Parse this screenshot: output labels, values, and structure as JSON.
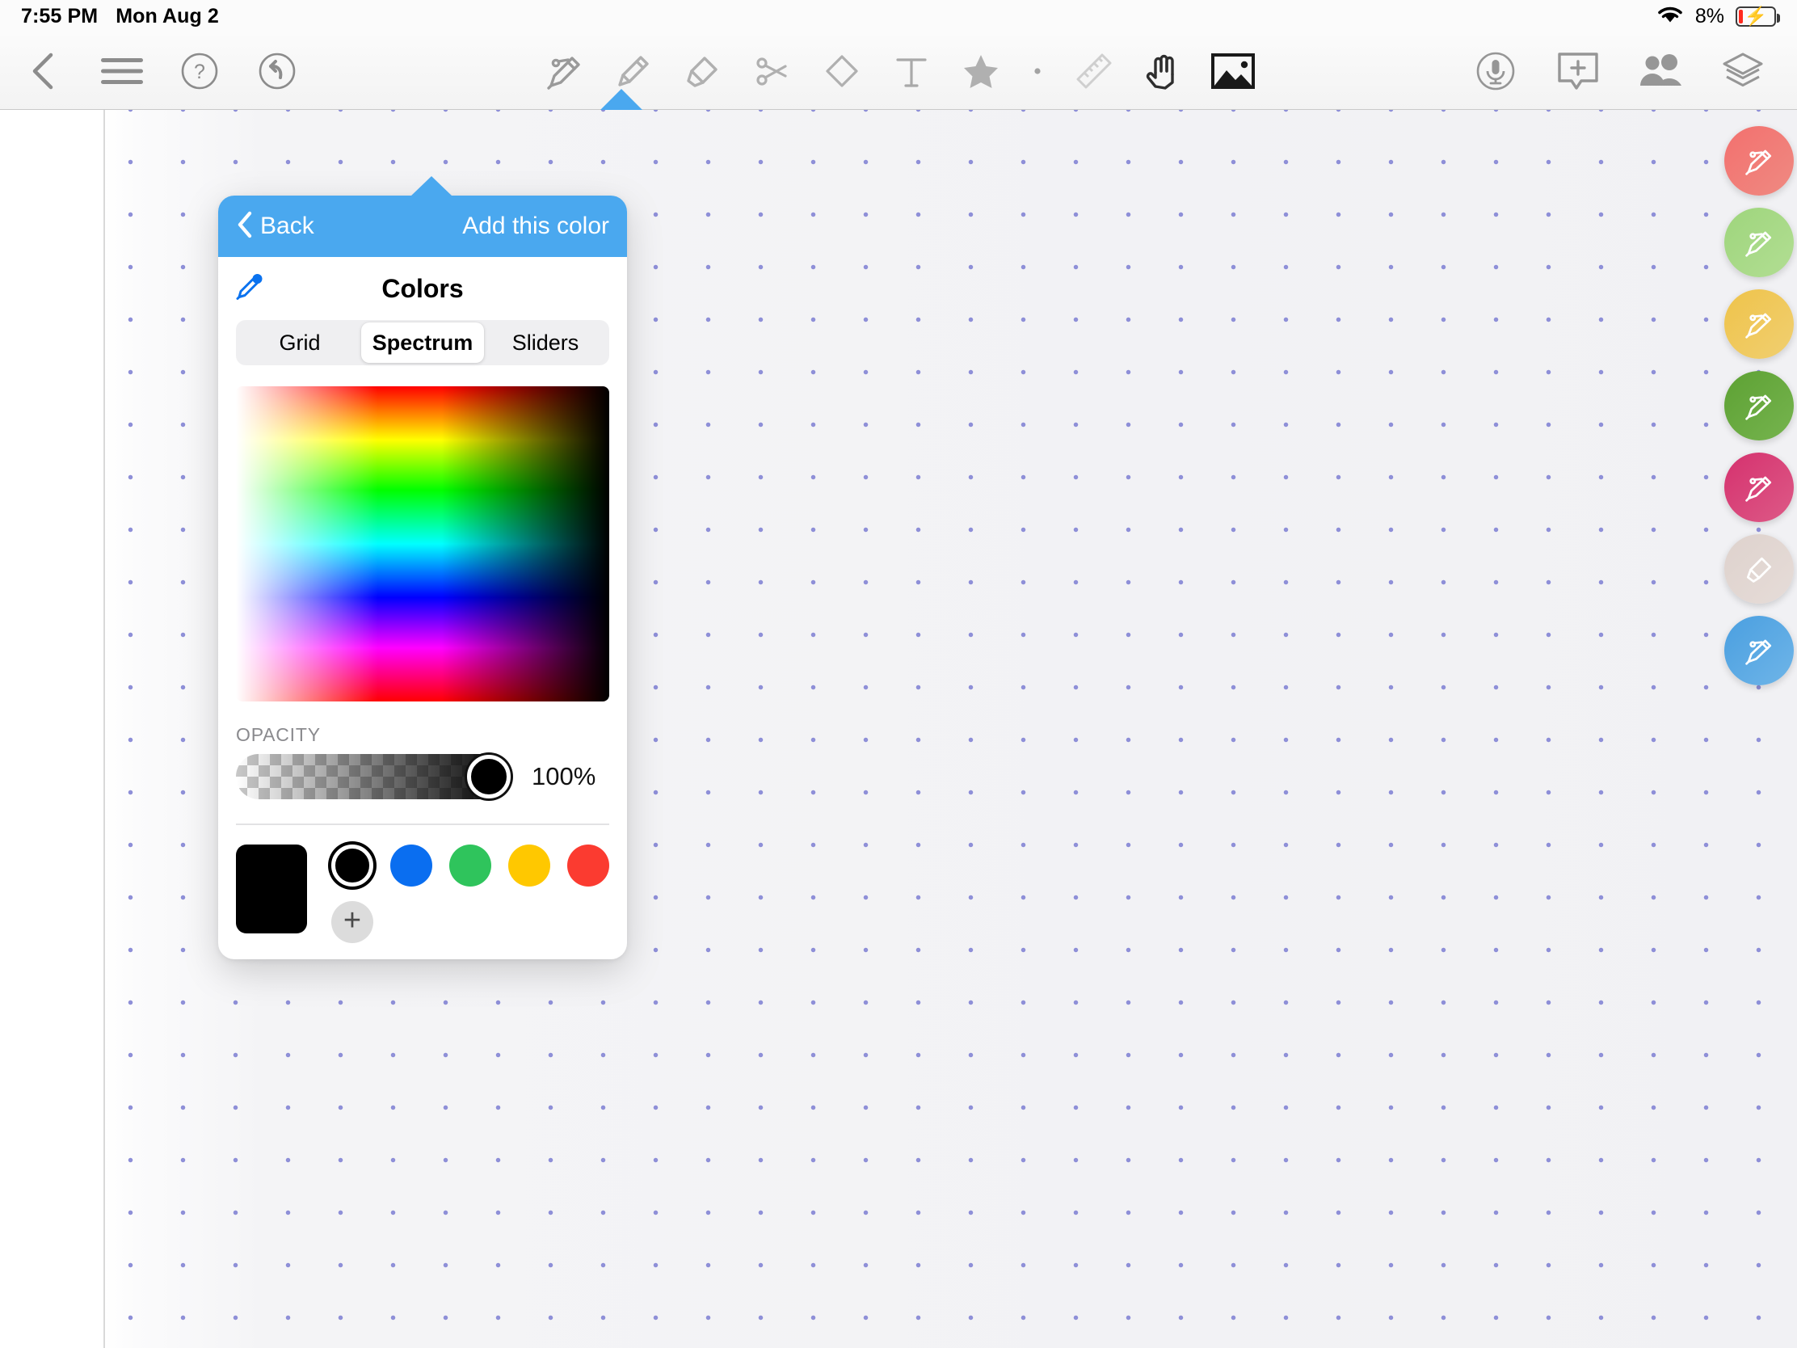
{
  "status_bar": {
    "time": "7:55 PM",
    "date": "Mon Aug 2",
    "battery_percent": "8%",
    "wifi_icon": "wifi-icon",
    "battery_icon": "battery-charging-icon"
  },
  "toolbar": {
    "left_tools": [
      {
        "name": "back-button",
        "icon": "chevron-left-icon"
      },
      {
        "name": "menu-button",
        "icon": "hamburger-menu-icon"
      },
      {
        "name": "help-button",
        "icon": "question-mark-circle-icon"
      },
      {
        "name": "undo-button",
        "icon": "undo-arrow-circle-icon"
      }
    ],
    "center_tools": [
      {
        "name": "pen-tool",
        "icon": "pen-icon",
        "active": true
      },
      {
        "name": "pencil-tool",
        "icon": "pencil-icon",
        "active": false
      },
      {
        "name": "highlighter-tool",
        "icon": "highlighter-icon",
        "active": false
      },
      {
        "name": "scissors-tool",
        "icon": "scissors-icon",
        "active": false
      },
      {
        "name": "eraser-tool",
        "icon": "eraser-icon",
        "active": false
      },
      {
        "name": "text-tool",
        "icon": "text-t-icon",
        "active": false
      },
      {
        "name": "shape-tool",
        "icon": "star-icon",
        "active": false
      },
      {
        "name": "dot-tool",
        "icon": "dot-icon",
        "active": false
      },
      {
        "name": "ruler-tool",
        "icon": "ruler-icon",
        "active": false
      },
      {
        "name": "hand-tool",
        "icon": "hand-icon",
        "active": true
      },
      {
        "name": "image-tool",
        "icon": "image-icon",
        "active": true
      }
    ],
    "right_tools": [
      {
        "name": "record-audio-button",
        "icon": "microphone-circle-icon"
      },
      {
        "name": "add-comment-button",
        "icon": "comment-plus-icon"
      },
      {
        "name": "share-collaborate-button",
        "icon": "people-icon"
      },
      {
        "name": "layers-button",
        "icon": "layers-icon"
      }
    ]
  },
  "pen_rail": {
    "label": "pen-presets",
    "pens": [
      {
        "name": "pen-preset-red",
        "color_start": "#f3706e",
        "color_end": "#ef8a82",
        "icon": "pen-icon"
      },
      {
        "name": "pen-preset-light-green",
        "color_start": "#9ed57c",
        "color_end": "#b2de93",
        "icon": "pen-icon"
      },
      {
        "name": "pen-preset-yellow",
        "color_start": "#efc34a",
        "color_end": "#f0cf71",
        "icon": "pen-icon"
      },
      {
        "name": "pen-preset-dark-green",
        "color_start": "#5da133",
        "color_end": "#76b44f",
        "icon": "pen-icon"
      },
      {
        "name": "pen-preset-pink",
        "color_start": "#d5316e",
        "color_end": "#dd5a87",
        "icon": "pen-icon"
      },
      {
        "name": "pen-preset-beige-highlighter",
        "color_start": "#ded2cd",
        "color_end": "#e6dcd8",
        "icon": "highlighter-icon"
      },
      {
        "name": "pen-preset-blue",
        "color_start": "#4a9fe0",
        "color_end": "#6fb5e8",
        "icon": "pen-icon"
      }
    ]
  },
  "color_popover": {
    "header": {
      "back_label": "Back",
      "back_icon": "chevron-left-icon",
      "add_color_label": "Add this color",
      "background_color": "#4aa8ef"
    },
    "title": "Colors",
    "eyedropper_icon": "eyedropper-icon",
    "eyedropper_color": "#0a72ef",
    "tabs": [
      {
        "label": "Grid",
        "selected": false
      },
      {
        "label": "Spectrum",
        "selected": true
      },
      {
        "label": "Sliders",
        "selected": false
      }
    ],
    "spectrum": {
      "name": "spectrum-picker",
      "hue_stops": [
        "#ff0000",
        "#ffff00",
        "#00ff00",
        "#00ffff",
        "#0000ff",
        "#ff00ff",
        "#ff0000"
      ],
      "horizontal": "white-to-black"
    },
    "opacity": {
      "label": "OPACITY",
      "value": "100%",
      "percent": 100
    },
    "selected_color_preview": "#000000",
    "swatches": [
      {
        "name": "swatch-black",
        "color": "#000000",
        "selected": true
      },
      {
        "name": "swatch-blue",
        "color": "#0a6ef0",
        "selected": false
      },
      {
        "name": "swatch-green",
        "color": "#2fc45c",
        "selected": false
      },
      {
        "name": "swatch-yellow",
        "color": "#ffc800",
        "selected": false
      },
      {
        "name": "swatch-red",
        "color": "#fb3b30",
        "selected": false
      }
    ],
    "add_swatch_label": "+"
  }
}
